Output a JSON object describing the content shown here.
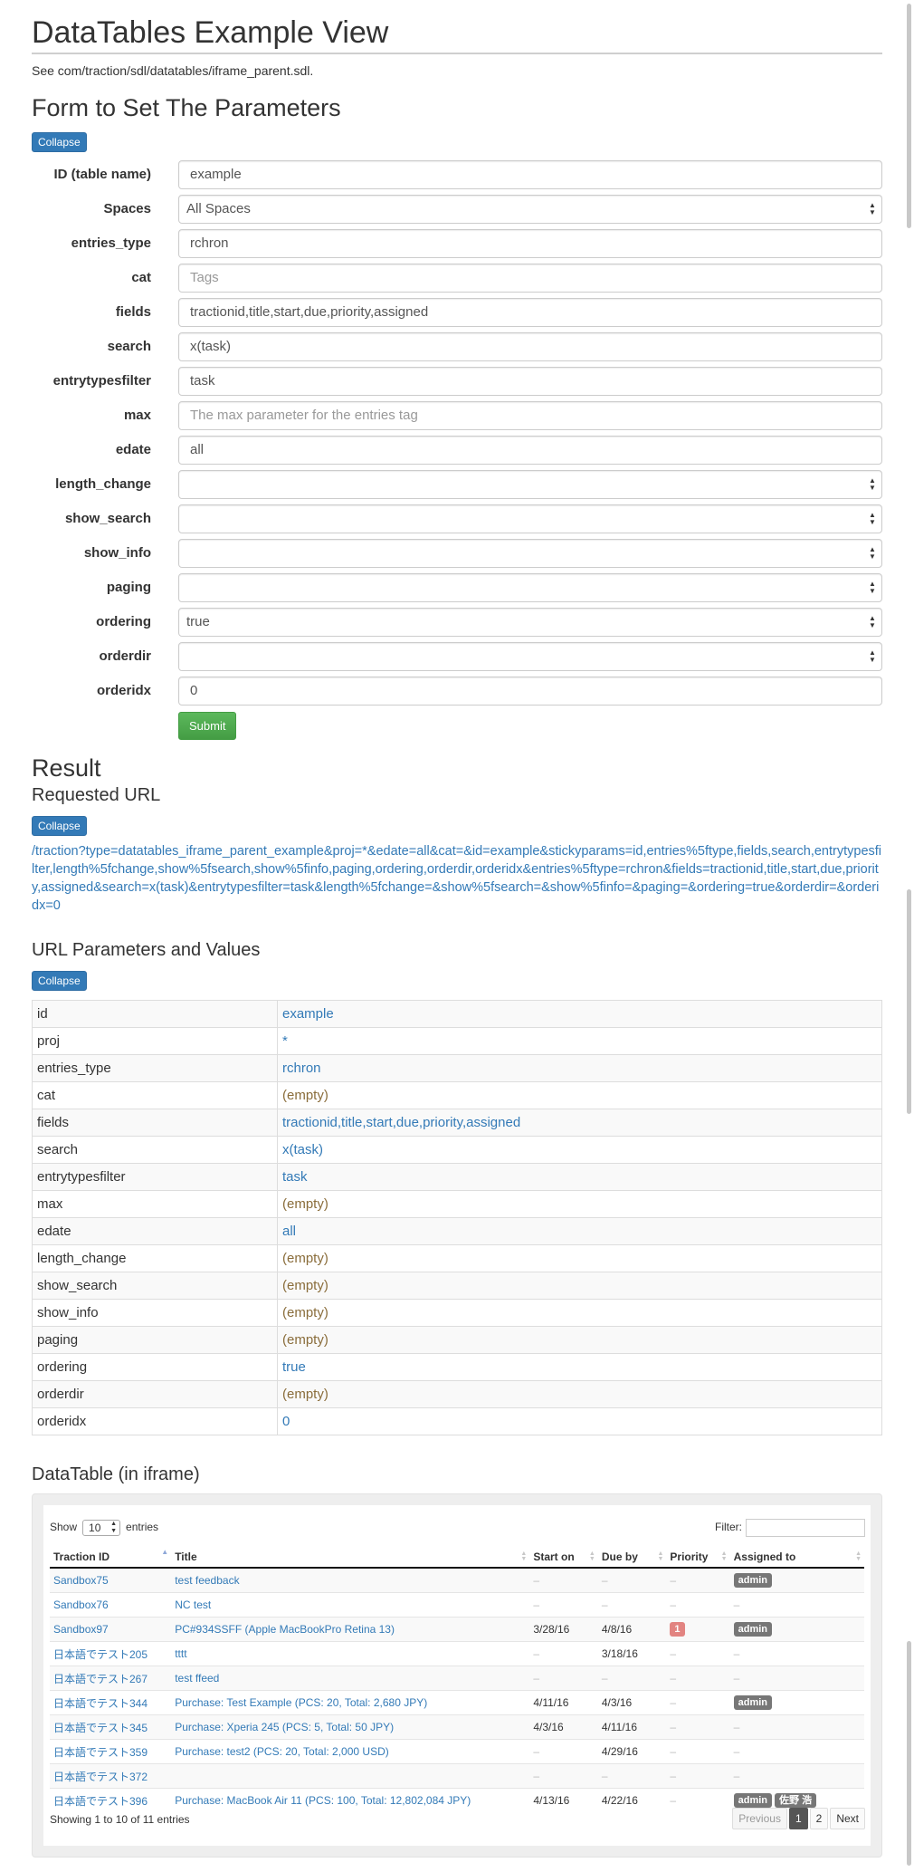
{
  "header": {
    "title": "DataTables Example View",
    "subtitle": "See com/traction/sdl/datatables/iframe_parent.sdl."
  },
  "form": {
    "heading": "Form to Set The Parameters",
    "collapse_label": "Collapse",
    "fields": [
      {
        "label": "ID (table name)",
        "type": "input",
        "value": "example",
        "placeholder": ""
      },
      {
        "label": "Spaces",
        "type": "select",
        "value": "All Spaces"
      },
      {
        "label": "entries_type",
        "type": "input",
        "value": "rchron",
        "placeholder": ""
      },
      {
        "label": "cat",
        "type": "input",
        "value": "",
        "placeholder": "Tags"
      },
      {
        "label": "fields",
        "type": "input",
        "value": "tractionid,title,start,due,priority,assigned",
        "placeholder": ""
      },
      {
        "label": "search",
        "type": "input",
        "value": "x(task)",
        "placeholder": ""
      },
      {
        "label": "entrytypesfilter",
        "type": "input",
        "value": "task",
        "placeholder": ""
      },
      {
        "label": "max",
        "type": "input",
        "value": "",
        "placeholder": "The max parameter for the entries tag"
      },
      {
        "label": "edate",
        "type": "input",
        "value": "all",
        "placeholder": ""
      },
      {
        "label": "length_change",
        "type": "select",
        "value": ""
      },
      {
        "label": "show_search",
        "type": "select",
        "value": ""
      },
      {
        "label": "show_info",
        "type": "select",
        "value": ""
      },
      {
        "label": "paging",
        "type": "select",
        "value": ""
      },
      {
        "label": "ordering",
        "type": "select",
        "value": "true"
      },
      {
        "label": "orderdir",
        "type": "select",
        "value": ""
      },
      {
        "label": "orderidx",
        "type": "input",
        "value": "0",
        "placeholder": ""
      }
    ],
    "submit_label": "Submit"
  },
  "result": {
    "heading": "Result",
    "requested_url_heading": "Requested URL",
    "collapse_label": "Collapse",
    "requested_url": "/traction?type=datatables_iframe_parent_example&proj=*&edate=all&cat=&id=example&stickyparams=id,entries%5ftype,fields,search,entrytypesfilter,length%5fchange,show%5fsearch,show%5finfo,paging,ordering,orderdir,orderidx&entries%5ftype=rchron&fields=tractionid,title,start,due,priority,assigned&search=x(task)&entrytypesfilter=task&length%5fchange=&show%5fsearch=&show%5finfo=&paging=&ordering=true&orderdir=&orderidx=0",
    "url_params_heading": "URL Parameters and Values",
    "params_collapse_label": "Collapse",
    "params": [
      {
        "key": "id",
        "value": "example",
        "empty": false
      },
      {
        "key": "proj",
        "value": "*",
        "empty": false
      },
      {
        "key": "entries_type",
        "value": "rchron",
        "empty": false
      },
      {
        "key": "cat",
        "value": "(empty)",
        "empty": true
      },
      {
        "key": "fields",
        "value": "tractionid,title,start,due,priority,assigned",
        "empty": false
      },
      {
        "key": "search",
        "value": "x(task)",
        "empty": false
      },
      {
        "key": "entrytypesfilter",
        "value": "task",
        "empty": false
      },
      {
        "key": "max",
        "value": "(empty)",
        "empty": true
      },
      {
        "key": "edate",
        "value": "all",
        "empty": false
      },
      {
        "key": "length_change",
        "value": "(empty)",
        "empty": true
      },
      {
        "key": "show_search",
        "value": "(empty)",
        "empty": true
      },
      {
        "key": "show_info",
        "value": "(empty)",
        "empty": true
      },
      {
        "key": "paging",
        "value": "(empty)",
        "empty": true
      },
      {
        "key": "ordering",
        "value": "true",
        "empty": false
      },
      {
        "key": "orderdir",
        "value": "(empty)",
        "empty": true
      },
      {
        "key": "orderidx",
        "value": "0",
        "empty": false
      }
    ]
  },
  "datatable": {
    "heading": "DataTable (in iframe)",
    "show_label": "Show",
    "entries_label": "entries",
    "length_value": "10",
    "filter_label": "Filter:",
    "columns": [
      "Traction ID",
      "Title",
      "Start on",
      "Due by",
      "Priority",
      "Assigned to"
    ],
    "rows": [
      {
        "id": "Sandbox75",
        "title": "test feedback",
        "start": "",
        "due": "",
        "priority": "",
        "assigned": [
          "admin"
        ]
      },
      {
        "id": "Sandbox76",
        "title": "NC test",
        "start": "",
        "due": "",
        "priority": "",
        "assigned": []
      },
      {
        "id": "Sandbox97",
        "title": "PC#934SSFF (Apple MacBookPro Retina 13)",
        "start": "3/28/16",
        "due": "4/8/16",
        "priority": "1",
        "assigned": [
          "admin"
        ]
      },
      {
        "id": "日本語でテスト205",
        "title": "tttt",
        "start": "",
        "due": "3/18/16",
        "priority": "",
        "assigned": []
      },
      {
        "id": "日本語でテスト267",
        "title": "test ffeed",
        "start": "",
        "due": "",
        "priority": "",
        "assigned": []
      },
      {
        "id": "日本語でテスト344",
        "title": "Purchase: Test Example (PCS: 20, Total: 2,680 JPY)",
        "start": "4/11/16",
        "due": "4/3/16",
        "priority": "",
        "assigned": [
          "admin"
        ]
      },
      {
        "id": "日本語でテスト345",
        "title": "Purchase: Xperia 245 (PCS: 5, Total: 50 JPY)",
        "start": "4/3/16",
        "due": "4/11/16",
        "priority": "",
        "assigned": []
      },
      {
        "id": "日本語でテスト359",
        "title": "Purchase: test2 (PCS: 20, Total: 2,000 USD)",
        "start": "",
        "due": "4/29/16",
        "priority": "",
        "assigned": []
      },
      {
        "id": "日本語でテスト372",
        "title": "",
        "start": "",
        "due": "",
        "priority": "",
        "assigned": []
      },
      {
        "id": "日本語でテスト396",
        "title": "Purchase: MacBook Air 11 (PCS: 100, Total: 12,802,084 JPY)",
        "start": "4/13/16",
        "due": "4/22/16",
        "priority": "",
        "assigned": [
          "admin",
          "佐野 浩"
        ]
      }
    ],
    "empty_marker": "–",
    "info": "Showing 1 to 10 of 11 entries",
    "pagination": {
      "previous": "Previous",
      "pages": [
        "1",
        "2"
      ],
      "current": "1",
      "next": "Next"
    }
  }
}
